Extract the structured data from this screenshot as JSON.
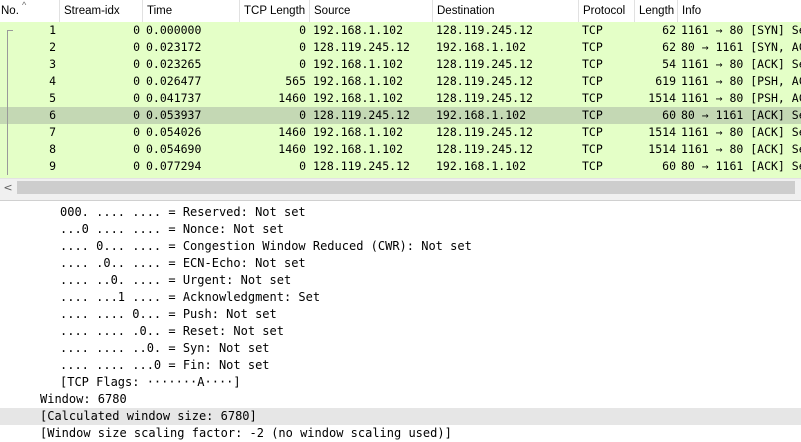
{
  "columns": {
    "no": "No.",
    "stream_idx": "Stream-idx",
    "time": "Time",
    "tcp_length": "TCP Length",
    "source": "Source",
    "destination": "Destination",
    "protocol": "Protocol",
    "length": "Length",
    "info": "Info"
  },
  "packets": [
    {
      "no": "1",
      "stream": "0",
      "time": "0.000000",
      "tcplen": "0",
      "src": "192.168.1.102",
      "dst": "128.119.245.12",
      "proto": "TCP",
      "len": "62",
      "info": "1161 → 80 [SYN] Se"
    },
    {
      "no": "2",
      "stream": "0",
      "time": "0.023172",
      "tcplen": "0",
      "src": "128.119.245.12",
      "dst": "192.168.1.102",
      "proto": "TCP",
      "len": "62",
      "info": "80 → 1161 [SYN, AC"
    },
    {
      "no": "3",
      "stream": "0",
      "time": "0.023265",
      "tcplen": "0",
      "src": "192.168.1.102",
      "dst": "128.119.245.12",
      "proto": "TCP",
      "len": "54",
      "info": "1161 → 80 [ACK] Se"
    },
    {
      "no": "4",
      "stream": "0",
      "time": "0.026477",
      "tcplen": "565",
      "src": "192.168.1.102",
      "dst": "128.119.245.12",
      "proto": "TCP",
      "len": "619",
      "info": "1161 → 80 [PSH, AC"
    },
    {
      "no": "5",
      "stream": "0",
      "time": "0.041737",
      "tcplen": "1460",
      "src": "192.168.1.102",
      "dst": "128.119.245.12",
      "proto": "TCP",
      "len": "1514",
      "info": "1161 → 80 [PSH, AC"
    },
    {
      "no": "6",
      "stream": "0",
      "time": "0.053937",
      "tcplen": "0",
      "src": "128.119.245.12",
      "dst": "192.168.1.102",
      "proto": "TCP",
      "len": "60",
      "info": "80 → 1161 [ACK] Se"
    },
    {
      "no": "7",
      "stream": "0",
      "time": "0.054026",
      "tcplen": "1460",
      "src": "192.168.1.102",
      "dst": "128.119.245.12",
      "proto": "TCP",
      "len": "1514",
      "info": "1161 → 80 [ACK] Se"
    },
    {
      "no": "8",
      "stream": "0",
      "time": "0.054690",
      "tcplen": "1460",
      "src": "192.168.1.102",
      "dst": "128.119.245.12",
      "proto": "TCP",
      "len": "1514",
      "info": "1161 → 80 [ACK] Se"
    },
    {
      "no": "9",
      "stream": "0",
      "time": "0.077294",
      "tcplen": "0",
      "src": "128.119.245.12",
      "dst": "192.168.1.102",
      "proto": "TCP",
      "len": "60",
      "info": "80 → 1161 [ACK] Se"
    }
  ],
  "selected_packet": "6",
  "row_background": "#e4ffc7",
  "selected_background": "#c4d8b4",
  "scroll_left_icon": "chevron-left-icon",
  "details": [
    {
      "indent": 1,
      "text": "000. .... .... = Reserved: Not set"
    },
    {
      "indent": 1,
      "text": "...0 .... .... = Nonce: Not set"
    },
    {
      "indent": 1,
      "text": ".... 0... .... = Congestion Window Reduced (CWR): Not set"
    },
    {
      "indent": 1,
      "text": ".... .0.. .... = ECN-Echo: Not set"
    },
    {
      "indent": 1,
      "text": ".... ..0. .... = Urgent: Not set"
    },
    {
      "indent": 1,
      "text": ".... ...1 .... = Acknowledgment: Set"
    },
    {
      "indent": 1,
      "text": ".... .... 0... = Push: Not set"
    },
    {
      "indent": 1,
      "text": ".... .... .0.. = Reset: Not set"
    },
    {
      "indent": 1,
      "text": ".... .... ..0. = Syn: Not set"
    },
    {
      "indent": 1,
      "text": ".... .... ...0 = Fin: Not set"
    },
    {
      "indent": 1,
      "text": "[TCP Flags: ·······A····]"
    },
    {
      "indent": 0,
      "text": "Window: 6780"
    },
    {
      "indent": 0,
      "text": "[Calculated window size: 6780]",
      "highlight": true
    },
    {
      "indent": 0,
      "text": "[Window size scaling factor: -2 (no window scaling used)]"
    }
  ]
}
